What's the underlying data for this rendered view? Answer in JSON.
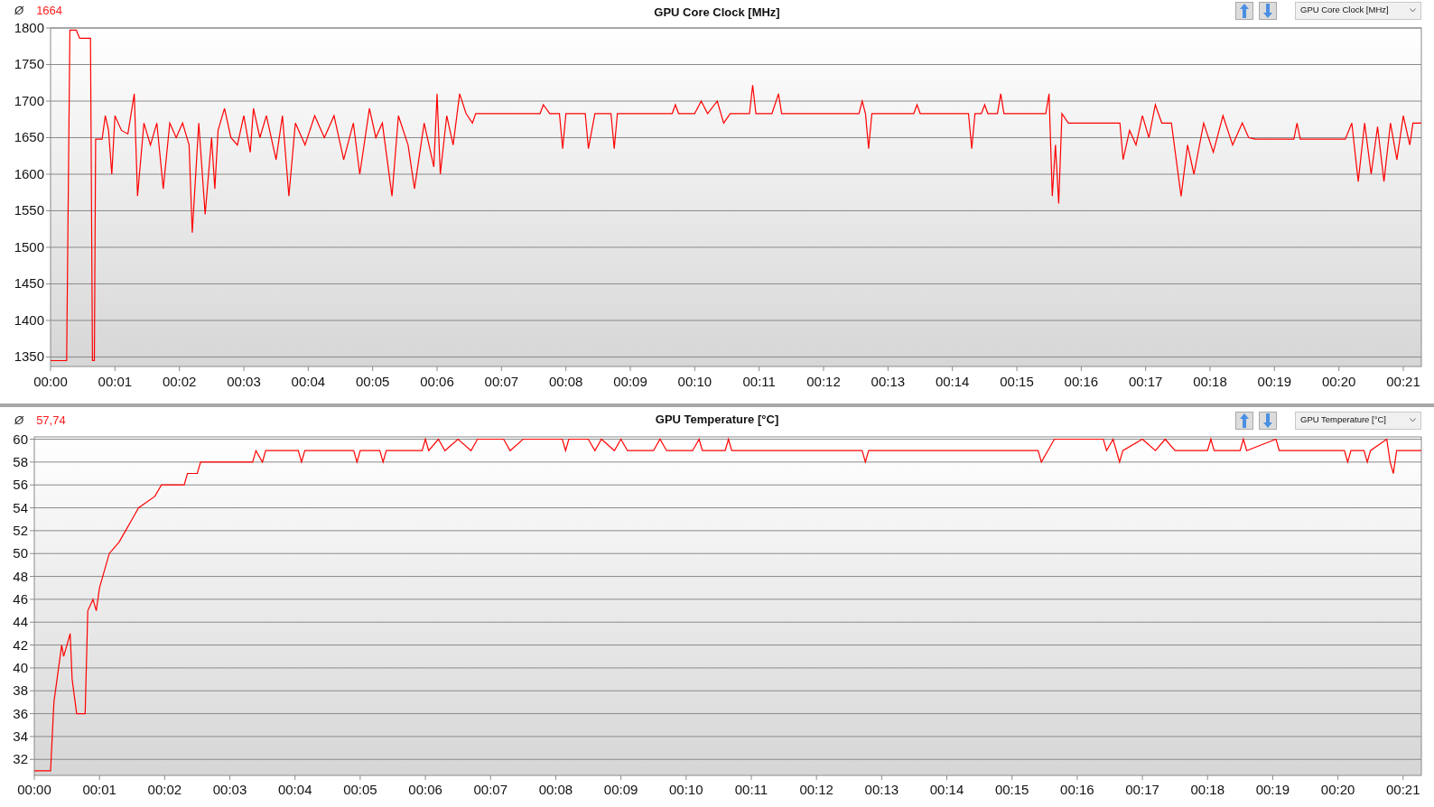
{
  "panels": [
    {
      "average_symbol": "Ø",
      "average": "1664",
      "selector": {
        "value": "GPU Core Clock [MHz]"
      },
      "chart_data": {
        "type": "line",
        "title": "GPU Core Clock [MHz]",
        "grid": true,
        "xlim": [
          0,
          21.28
        ],
        "ylim": [
          1337,
          1800
        ],
        "xticks": [
          {
            "value": 0,
            "label": "00:00"
          },
          {
            "value": 1,
            "label": "00:01"
          },
          {
            "value": 2,
            "label": "00:02"
          },
          {
            "value": 3,
            "label": "00:03"
          },
          {
            "value": 4,
            "label": "00:04"
          },
          {
            "value": 5,
            "label": "00:05"
          },
          {
            "value": 6,
            "label": "00:06"
          },
          {
            "value": 7,
            "label": "00:07"
          },
          {
            "value": 8,
            "label": "00:08"
          },
          {
            "value": 9,
            "label": "00:09"
          },
          {
            "value": 10,
            "label": "00:10"
          },
          {
            "value": 11,
            "label": "00:11"
          },
          {
            "value": 12,
            "label": "00:12"
          },
          {
            "value": 13,
            "label": "00:13"
          },
          {
            "value": 14,
            "label": "00:14"
          },
          {
            "value": 15,
            "label": "00:15"
          },
          {
            "value": 16,
            "label": "00:16"
          },
          {
            "value": 17,
            "label": "00:17"
          },
          {
            "value": 18,
            "label": "00:18"
          },
          {
            "value": 19,
            "label": "00:19"
          },
          {
            "value": 20,
            "label": "00:20"
          },
          {
            "value": 21,
            "label": "00:21"
          }
        ],
        "yticks": [
          1350,
          1400,
          1450,
          1500,
          1550,
          1600,
          1650,
          1700,
          1750,
          1800
        ],
        "x": [
          0,
          0.25,
          0.3,
          0.4,
          0.45,
          0.62,
          0.65,
          0.68,
          0.7,
          0.8,
          0.85,
          0.9,
          0.95,
          1.0,
          1.1,
          1.2,
          1.3,
          1.35,
          1.45,
          1.55,
          1.65,
          1.75,
          1.85,
          1.95,
          2.05,
          2.15,
          2.2,
          2.3,
          2.4,
          2.5,
          2.55,
          2.6,
          2.7,
          2.8,
          2.9,
          3.0,
          3.1,
          3.15,
          3.25,
          3.35,
          3.5,
          3.6,
          3.7,
          3.8,
          3.95,
          4.1,
          4.25,
          4.4,
          4.55,
          4.7,
          4.8,
          4.95,
          5.05,
          5.15,
          5.3,
          5.4,
          5.55,
          5.65,
          5.8,
          5.95,
          6.0,
          6.05,
          6.15,
          6.25,
          6.35,
          6.45,
          6.55,
          6.6,
          7.6,
          7.65,
          7.75,
          7.9,
          7.95,
          8.0,
          8.3,
          8.35,
          8.45,
          8.7,
          8.75,
          8.8,
          9.65,
          9.7,
          9.75,
          10.0,
          10.1,
          10.2,
          10.35,
          10.45,
          10.55,
          10.85,
          10.9,
          10.95,
          11.2,
          11.3,
          11.35,
          12.55,
          12.6,
          12.65,
          12.7,
          12.75,
          13.4,
          13.45,
          13.5,
          14.25,
          14.3,
          14.35,
          14.45,
          14.5,
          14.55,
          14.7,
          14.75,
          14.8,
          15.45,
          15.5,
          15.55,
          15.6,
          15.65,
          15.7,
          15.8,
          16.6,
          16.65,
          16.75,
          16.85,
          16.95,
          17.05,
          17.15,
          17.25,
          17.4,
          17.55,
          17.65,
          17.75,
          17.9,
          18.05,
          18.2,
          18.35,
          18.5,
          18.6,
          18.7,
          19.3,
          19.35,
          19.4,
          20.1,
          20.2,
          20.3,
          20.4,
          20.5,
          20.6,
          20.7,
          20.8,
          20.9,
          21.0,
          21.1,
          21.15,
          21.28
        ],
        "series": [
          {
            "color": "#ff0000",
            "values": [
              1345,
              1345,
              1797,
              1797,
              1786,
              1786,
              1345,
              1345,
              1648,
              1648,
              1680,
              1660,
              1600,
              1680,
              1660,
              1655,
              1710,
              1570,
              1670,
              1640,
              1670,
              1580,
              1670,
              1650,
              1670,
              1640,
              1520,
              1670,
              1545,
              1650,
              1580,
              1660,
              1690,
              1650,
              1640,
              1680,
              1630,
              1690,
              1650,
              1680,
              1620,
              1680,
              1570,
              1670,
              1640,
              1680,
              1650,
              1680,
              1620,
              1670,
              1600,
              1690,
              1650,
              1670,
              1570,
              1680,
              1640,
              1580,
              1670,
              1610,
              1710,
              1600,
              1680,
              1640,
              1710,
              1683,
              1670,
              1683,
              1683,
              1695,
              1683,
              1683,
              1635,
              1683,
              1683,
              1635,
              1683,
              1683,
              1635,
              1683,
              1683,
              1695,
              1683,
              1683,
              1700,
              1683,
              1700,
              1670,
              1683,
              1683,
              1722,
              1683,
              1683,
              1710,
              1683,
              1683,
              1700,
              1683,
              1635,
              1683,
              1683,
              1695,
              1683,
              1683,
              1635,
              1683,
              1683,
              1695,
              1683,
              1683,
              1710,
              1683,
              1683,
              1710,
              1570,
              1640,
              1560,
              1683,
              1670,
              1670,
              1620,
              1660,
              1640,
              1680,
              1650,
              1695,
              1670,
              1670,
              1570,
              1640,
              1600,
              1670,
              1630,
              1680,
              1640,
              1670,
              1650,
              1648,
              1648,
              1670,
              1648,
              1648,
              1670,
              1590,
              1670,
              1600,
              1665,
              1590,
              1670,
              1620,
              1680,
              1640,
              1670,
              1670
            ]
          }
        ]
      }
    },
    {
      "average_symbol": "Ø",
      "average": "57,74",
      "selector": {
        "value": "GPU Temperature [°C]"
      },
      "chart_data": {
        "type": "line",
        "title": "GPU Temperature [°C]",
        "grid": true,
        "xlim": [
          0,
          21.28
        ],
        "ylim": [
          30.6,
          60.2
        ],
        "xticks": [
          {
            "value": 0,
            "label": "00:00"
          },
          {
            "value": 1,
            "label": "00:01"
          },
          {
            "value": 2,
            "label": "00:02"
          },
          {
            "value": 3,
            "label": "00:03"
          },
          {
            "value": 4,
            "label": "00:04"
          },
          {
            "value": 5,
            "label": "00:05"
          },
          {
            "value": 6,
            "label": "00:06"
          },
          {
            "value": 7,
            "label": "00:07"
          },
          {
            "value": 8,
            "label": "00:08"
          },
          {
            "value": 9,
            "label": "00:09"
          },
          {
            "value": 10,
            "label": "00:10"
          },
          {
            "value": 11,
            "label": "00:11"
          },
          {
            "value": 12,
            "label": "00:12"
          },
          {
            "value": 13,
            "label": "00:13"
          },
          {
            "value": 14,
            "label": "00:14"
          },
          {
            "value": 15,
            "label": "00:15"
          },
          {
            "value": 16,
            "label": "00:16"
          },
          {
            "value": 17,
            "label": "00:17"
          },
          {
            "value": 18,
            "label": "00:18"
          },
          {
            "value": 19,
            "label": "00:19"
          },
          {
            "value": 20,
            "label": "00:20"
          },
          {
            "value": 21,
            "label": "00:21"
          }
        ],
        "yticks": [
          32,
          34,
          36,
          38,
          40,
          42,
          44,
          46,
          48,
          50,
          52,
          54,
          56,
          58,
          60
        ],
        "x": [
          0,
          0.25,
          0.3,
          0.42,
          0.45,
          0.5,
          0.55,
          0.58,
          0.65,
          0.78,
          0.82,
          0.9,
          0.95,
          1.0,
          1.1,
          1.15,
          1.3,
          1.4,
          1.5,
          1.6,
          1.85,
          1.95,
          2.3,
          2.35,
          2.5,
          2.55,
          3.35,
          3.4,
          3.5,
          3.55,
          4.05,
          4.1,
          4.15,
          4.9,
          4.95,
          5.0,
          5.3,
          5.35,
          5.4,
          5.95,
          6.0,
          6.05,
          6.2,
          6.3,
          6.5,
          6.7,
          6.8,
          7.2,
          7.3,
          7.5,
          8.1,
          8.15,
          8.2,
          8.5,
          8.6,
          8.7,
          8.9,
          9.0,
          9.1,
          9.5,
          9.6,
          9.7,
          10.1,
          10.2,
          10.25,
          10.6,
          10.65,
          10.7,
          11.1,
          12.7,
          12.75,
          12.8,
          15.4,
          15.45,
          15.55,
          15.65,
          16.4,
          16.45,
          16.55,
          16.65,
          16.7,
          17.0,
          17.2,
          17.35,
          17.5,
          18.0,
          18.05,
          18.1,
          18.5,
          18.55,
          18.6,
          19.05,
          19.1,
          20.1,
          20.15,
          20.2,
          20.4,
          20.45,
          20.5,
          20.75,
          20.8,
          20.85,
          20.9,
          21.28
        ],
        "series": [
          {
            "color": "#ff0000",
            "values": [
              31,
              31,
              37,
              42,
              41,
              42,
              43,
              39,
              36,
              36,
              45,
              46,
              45,
              47,
              49,
              50,
              51,
              52,
              53,
              54,
              55,
              56,
              56,
              57,
              57,
              58,
              58,
              59,
              58,
              59,
              59,
              58,
              59,
              59,
              58,
              59,
              59,
              58,
              59,
              59,
              60,
              59,
              60,
              59,
              60,
              59,
              60,
              60,
              59,
              60,
              60,
              59,
              60,
              60,
              59,
              60,
              59,
              60,
              59,
              59,
              60,
              59,
              59,
              60,
              59,
              59,
              60,
              59,
              59,
              59,
              58,
              59,
              59,
              58,
              59,
              60,
              60,
              59,
              60,
              58,
              59,
              60,
              59,
              60,
              59,
              59,
              60,
              59,
              59,
              60,
              59,
              60,
              59,
              59,
              58,
              59,
              59,
              58,
              59,
              60,
              58,
              57,
              59,
              59
            ]
          }
        ]
      }
    }
  ]
}
